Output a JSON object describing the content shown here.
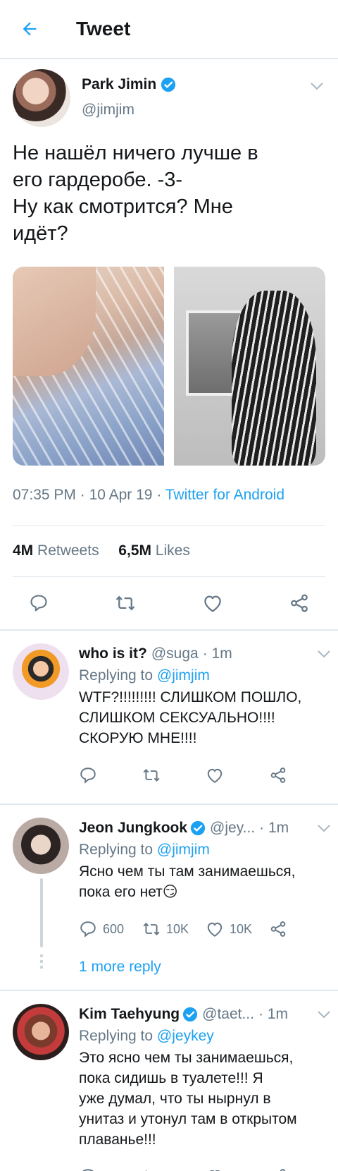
{
  "header": {
    "title": "Tweet"
  },
  "tweet": {
    "author_name": "Park Jimin",
    "author_handle": "@jimjim",
    "text": "Не нашёл ничего лучше в\nего гардеробе. -3-\nНу как смотрится? Мне\nидёт?",
    "time": "07:35 PM",
    "date": "10 Apr 19",
    "source": "Twitter for Android",
    "retweets_count": "4M",
    "retweets_label": "Retweets",
    "likes_count": "6,5M",
    "likes_label": "Likes"
  },
  "replies": [
    {
      "name": "who is it?",
      "handle": "@suga",
      "time": "· 1m",
      "replying_prefix": "Replying to",
      "replying_to": "@jimjim",
      "text": "WTF?!!!!!!!!! СЛИШКОМ ПОШЛО,\nСЛИШКОМ СЕКСУАЛЬНО!!!!\nСКОРУЮ МНЕ!!!!"
    },
    {
      "name": "Jeon Jungkook",
      "handle": "@jey...",
      "time": "· 1m",
      "replying_prefix": "Replying to",
      "replying_to": "@jimjim",
      "text": "Ясно чем ты там занимаешься,\nпока его нет😏",
      "reply_count": "600",
      "retweet_count": "10K",
      "like_count": "10K",
      "more_replies": "1 more reply"
    },
    {
      "name": "Kim Taehyung",
      "handle": "@taet...",
      "time": "· 1m",
      "replying_prefix": "Replying to",
      "replying_to": "@jeykey",
      "text": "Это ясно чем ты занимаешься,\nпока сидишь в туалете!!! Я\nуже думал, что ты нырнул в\nунитаз и утонул там в открытом\nплаванье!!!"
    }
  ],
  "colors": {
    "accent": "#1da1f2",
    "secondary_text": "#657786",
    "divider": "#e1e8ed"
  },
  "icons": [
    "back-arrow-icon",
    "verified-badge-icon",
    "chevron-down-icon",
    "reply-icon",
    "retweet-icon",
    "like-icon",
    "share-icon"
  ]
}
